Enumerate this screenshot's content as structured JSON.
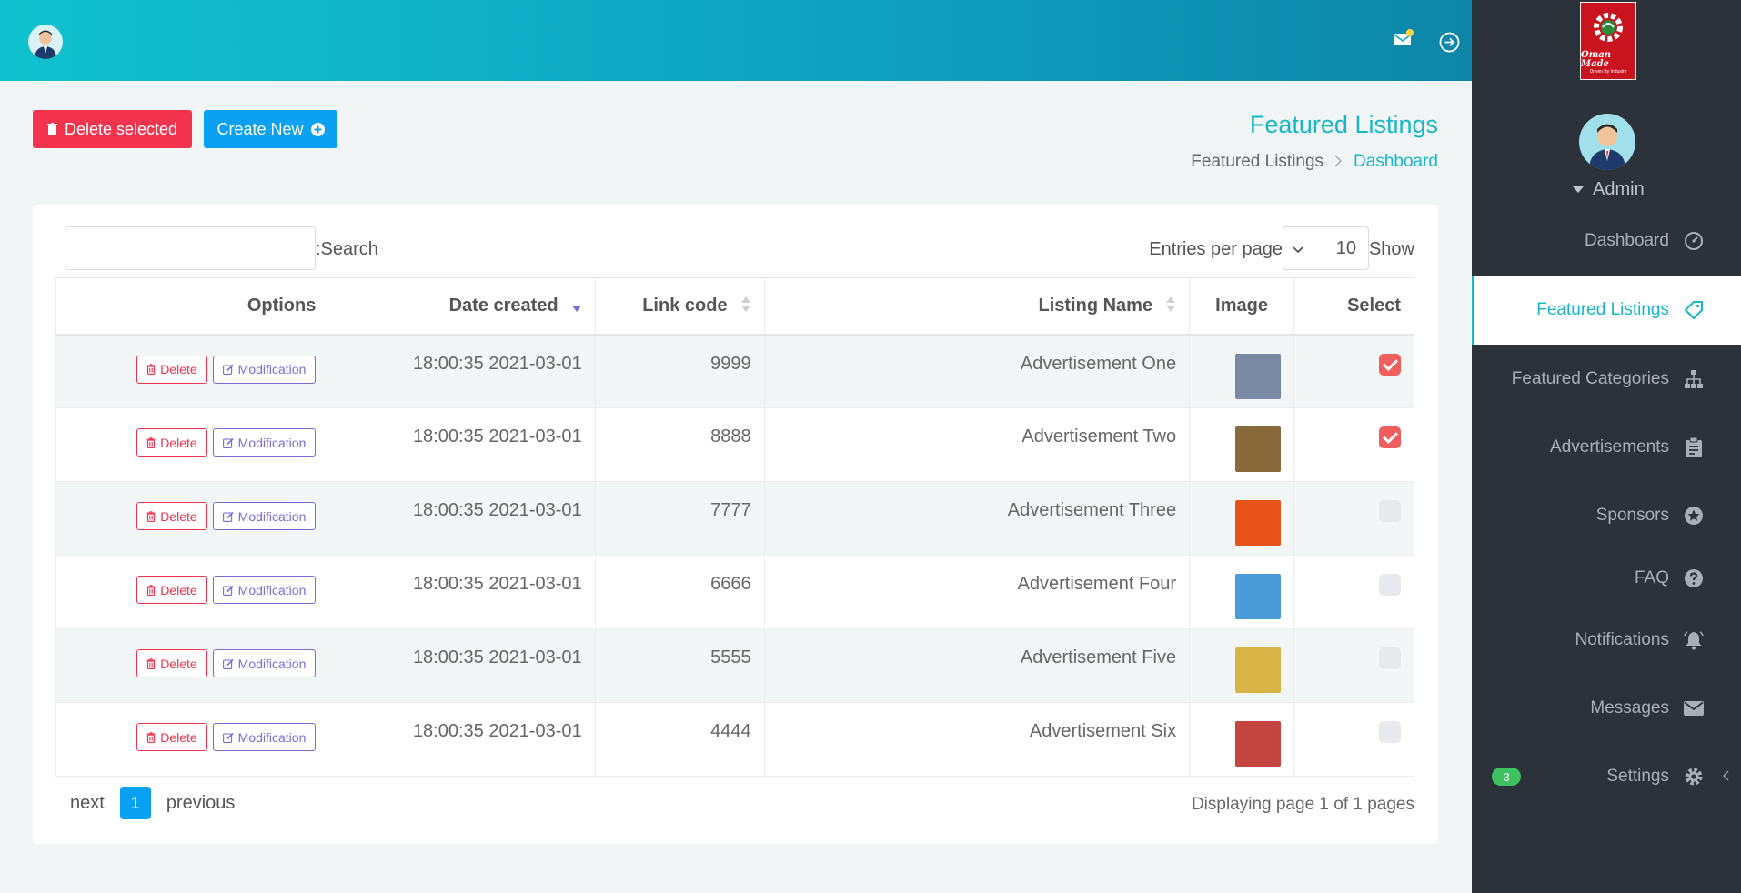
{
  "header": {
    "mail_icon": "mail-icon",
    "logout_icon": "logout-circle-arrow-icon"
  },
  "actions": {
    "delete_selected": "Delete selected",
    "create_new": "Create New"
  },
  "page": {
    "title": "Featured Listings",
    "breadcrumb": [
      "Featured Listings",
      "Dashboard"
    ]
  },
  "table_controls": {
    "search_label": ":Search",
    "search_value": "",
    "entries_label": "Entries per page",
    "entries_value": "10",
    "show_label": "Show"
  },
  "table": {
    "columns": [
      "Options",
      "Date created",
      "Link code",
      "Listing Name",
      "Image",
      "Select"
    ],
    "delete_label": "Delete",
    "modify_label": "Modification",
    "rows": [
      {
        "date": "18:00:35 2021-03-01",
        "code": "9999",
        "name": "Advertisement One",
        "checked": true,
        "thumb_color": "#7a8aa4"
      },
      {
        "date": "18:00:35 2021-03-01",
        "code": "8888",
        "name": "Advertisement Two",
        "checked": true,
        "thumb_color": "#8a6a3a"
      },
      {
        "date": "18:00:35 2021-03-01",
        "code": "7777",
        "name": "Advertisement Three",
        "checked": false,
        "thumb_color": "#e8531a"
      },
      {
        "date": "18:00:35 2021-03-01",
        "code": "6666",
        "name": "Advertisement Four",
        "checked": false,
        "thumb_color": "#4b9bd8"
      },
      {
        "date": "18:00:35 2021-03-01",
        "code": "5555",
        "name": "Advertisement Five",
        "checked": false,
        "thumb_color": "#d8b447"
      },
      {
        "date": "18:00:35 2021-03-01",
        "code": "4444",
        "name": "Advertisement Six",
        "checked": false,
        "thumb_color": "#c4453f"
      }
    ]
  },
  "pagination": {
    "next": "next",
    "current": "1",
    "previous": "previous",
    "info": "Displaying page 1 of 1 pages"
  },
  "sidebar": {
    "brand_name": "Oman Made",
    "brand_tag": "Driven By Industry",
    "user": "Admin",
    "items": [
      {
        "label": "Dashboard",
        "icon": "speedometer-icon",
        "active": false
      },
      {
        "label": "Featured Listings",
        "icon": "tag-icon",
        "active": true
      },
      {
        "label": "Featured Categories",
        "icon": "sitemap-icon",
        "active": false
      },
      {
        "label": "Advertisements",
        "icon": "clipboard-icon",
        "active": false
      },
      {
        "label": "Sponsors",
        "icon": "star-circle-icon",
        "active": false
      },
      {
        "label": "FAQ",
        "icon": "question-circle-icon",
        "active": false
      },
      {
        "label": "Notifications",
        "icon": "bell-icon",
        "active": false
      },
      {
        "label": "Messages",
        "icon": "envelope-icon",
        "active": false
      },
      {
        "label": "Settings",
        "icon": "gear-icon",
        "active": false,
        "badge": "3"
      }
    ]
  },
  "colors": {
    "accent": "#17b7c9",
    "danger": "#f4344f",
    "primary": "#0aa1f2",
    "sidebar_bg": "#2c3239"
  }
}
